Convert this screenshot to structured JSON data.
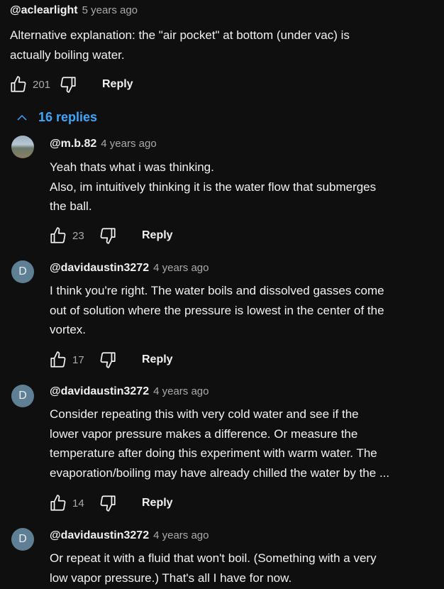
{
  "top_comment": {
    "author": "@aclearlight",
    "time": "5 years ago",
    "text": "Alternative explanation: the \"air pocket\" at bottom (under vac) is\nactually boiling water.",
    "likes": "201",
    "reply_label": "Reply"
  },
  "replies_toggle": {
    "label": "16 replies",
    "icon": "chevron-up-icon"
  },
  "replies": [
    {
      "avatar": "photo",
      "author": "@m.b.82",
      "time": "4 years ago",
      "text": "Yeah thats what i was thinking.\nAlso, im intuitively thinking it is the water flow that submerges\nthe ball.",
      "likes": "23",
      "reply_label": "Reply"
    },
    {
      "avatar": "D",
      "author": "@davidaustin3272",
      "time": "4 years ago",
      "text": "I think you're right. The water boils and dissolved gasses come\nout of solution where the pressure is lowest in the center of the\nvortex.",
      "likes": "17",
      "reply_label": "Reply"
    },
    {
      "avatar": "D",
      "author": "@davidaustin3272",
      "time": "4 years ago",
      "text": "Consider repeating this with very cold water and see if the\nlower vapor pressure makes a difference. Or measure the\ntemperature after doing this experiment with warm water. The\nevaporation/boiling may have already chilled the water by the ...",
      "likes": "14",
      "reply_label": "Reply"
    },
    {
      "avatar": "D",
      "author": "@davidaustin3272",
      "time": "4 years ago",
      "text": "Or repeat it with a fluid that won't boil. (Something with a very\nlow vapor pressure.) That's all I have for now.",
      "likes": "",
      "reply_label": "Reply"
    }
  ],
  "colors": {
    "background": "#0f0f0f",
    "link": "#3ea6ff",
    "muted": "#aaaaaa",
    "avatar": "#5f7f95"
  }
}
